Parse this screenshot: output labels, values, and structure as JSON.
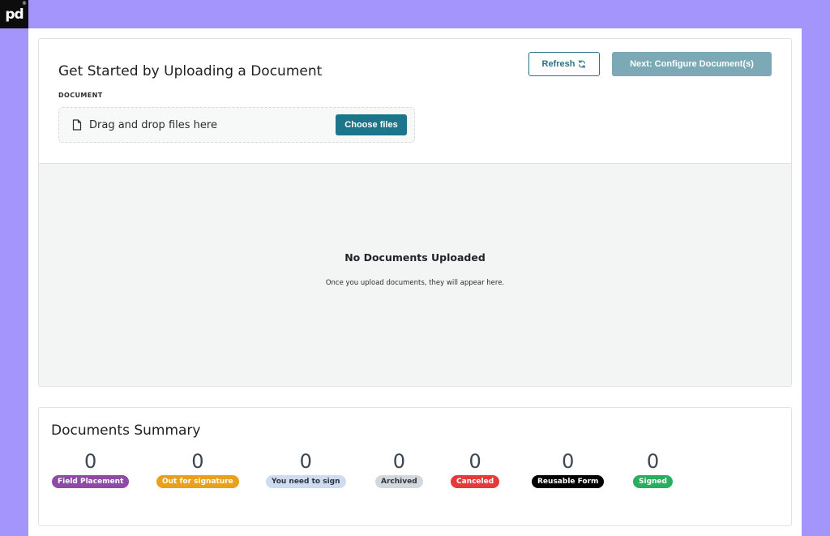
{
  "upload": {
    "title": "Get Started by Uploading a Document",
    "refresh_label": "Refresh",
    "next_label": "Next: Configure Document(s)",
    "document_label": "DOCUMENT",
    "dropzone_text": "Drag and drop files here",
    "choose_label": "Choose files",
    "empty_title": "No Documents Uploaded",
    "empty_subtitle": "Once you upload documents, they will appear here."
  },
  "summary": {
    "title": "Documents Summary",
    "stats": [
      {
        "value": "0",
        "label": "Field Placement",
        "color": "#8e4aa6"
      },
      {
        "value": "0",
        "label": "Out for signature",
        "color": "#e9a11b"
      },
      {
        "value": "0",
        "label": "You need to sign",
        "color": "#cfdcf0"
      },
      {
        "value": "0",
        "label": "Archived",
        "color": "#d4d8dc"
      },
      {
        "value": "0",
        "label": "Canceled",
        "color": "#e43a3a"
      },
      {
        "value": "0",
        "label": "Reusable Form",
        "color": "#000000"
      },
      {
        "value": "0",
        "label": "Signed",
        "color": "#27ae60"
      }
    ]
  },
  "colors": {
    "background": "#a395fb",
    "primary": "#1e7488",
    "primary_disabled": "#7ca9b6"
  }
}
